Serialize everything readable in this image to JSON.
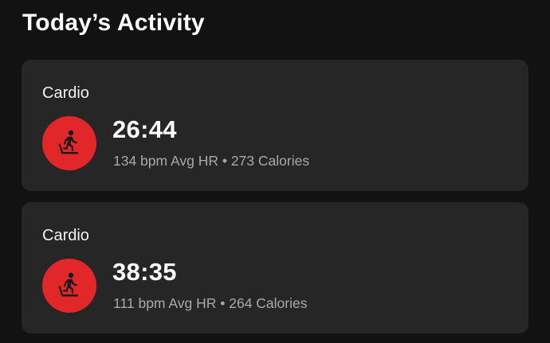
{
  "page": {
    "title": "Today’s Activity"
  },
  "colors": {
    "background": "#121212",
    "card": "#262626",
    "accent": "#e2272b",
    "secondary_text": "#a9a9a9"
  },
  "activities": [
    {
      "type": "Cardio",
      "icon": "treadmill-runner-icon",
      "duration": "26:44",
      "stats": "134 bpm Avg HR • 273 Calories"
    },
    {
      "type": "Cardio",
      "icon": "treadmill-runner-icon",
      "duration": "38:35",
      "stats": "111 bpm Avg HR • 264 Calories"
    }
  ]
}
